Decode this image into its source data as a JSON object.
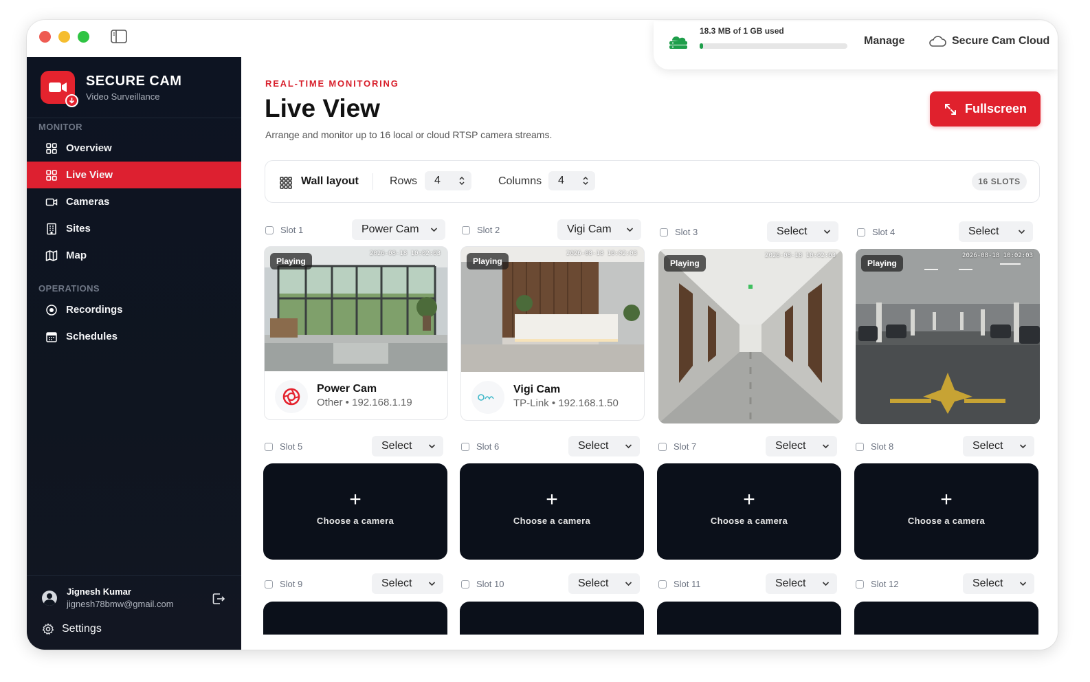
{
  "storage": {
    "used_text": "18.3 MB of 1 GB used",
    "used_fraction": 0.018,
    "manage_label": "Manage",
    "cloud_label": "Secure Cam Cloud",
    "accent": "#1e9e4a"
  },
  "brand": {
    "title": "SECURE CAM",
    "subtitle": "Video Surveillance",
    "color": "#e4232e"
  },
  "sidebar": {
    "sections": [
      {
        "label": "MONITOR",
        "items": [
          {
            "label": "Overview",
            "icon": "grid-icon",
            "active": false
          },
          {
            "label": "Live View",
            "icon": "grid-icon",
            "active": true
          },
          {
            "label": "Cameras",
            "icon": "camera-icon",
            "active": false
          },
          {
            "label": "Sites",
            "icon": "building-icon",
            "active": false
          },
          {
            "label": "Map",
            "icon": "map-icon",
            "active": false
          }
        ]
      },
      {
        "label": "OPERATIONS",
        "items": [
          {
            "label": "Recordings",
            "icon": "record-icon",
            "active": false
          },
          {
            "label": "Schedules",
            "icon": "calendar-icon",
            "active": false
          }
        ]
      }
    ],
    "user": {
      "name": "Jignesh Kumar",
      "email": "jignesh78bmw@gmail.com"
    },
    "settings_label": "Settings"
  },
  "header": {
    "eyebrow": "REAL-TIME MONITORING",
    "title": "Live View",
    "description": "Arrange and monitor up to 16 local or cloud RTSP camera streams.",
    "fullscreen_label": "Fullscreen"
  },
  "toolbar": {
    "wall_layout_label": "Wall layout",
    "rows_label": "Rows",
    "rows_value": "4",
    "columns_label": "Columns",
    "columns_value": "4",
    "slots_badge": "16 SLOTS"
  },
  "slots": [
    {
      "label": "Slot 1",
      "select": "Power Cam",
      "state": "card",
      "status": "Playing",
      "timestamp": "2026-08-18 10:02:03",
      "camera_name": "Power Cam",
      "camera_meta": "Other • 192.168.1.19",
      "scene": "lobby-glass"
    },
    {
      "label": "Slot 2",
      "select": "Vigi Cam",
      "state": "card",
      "status": "Playing",
      "timestamp": "2026-08-18 10:02:03",
      "camera_name": "Vigi Cam",
      "camera_meta": "TP-Link • 192.168.1.50",
      "scene": "reception"
    },
    {
      "label": "Slot 3",
      "select": "Select",
      "state": "feed",
      "status": "Playing",
      "timestamp": "2026-08-18 10:02:03",
      "scene": "corridor"
    },
    {
      "label": "Slot 4",
      "select": "Select",
      "state": "feed",
      "status": "Playing",
      "timestamp": "2026-08-18 10:02:03",
      "scene": "parking"
    },
    {
      "label": "Slot 5",
      "select": "Select",
      "state": "empty",
      "prompt": "Choose a camera"
    },
    {
      "label": "Slot 6",
      "select": "Select",
      "state": "empty",
      "prompt": "Choose a camera"
    },
    {
      "label": "Slot 7",
      "select": "Select",
      "state": "empty",
      "prompt": "Choose a camera"
    },
    {
      "label": "Slot 8",
      "select": "Select",
      "state": "empty",
      "prompt": "Choose a camera"
    },
    {
      "label": "Slot 9",
      "select": "Select",
      "state": "empty-clipped"
    },
    {
      "label": "Slot 10",
      "select": "Select",
      "state": "empty-clipped"
    },
    {
      "label": "Slot 11",
      "select": "Select",
      "state": "empty-clipped"
    },
    {
      "label": "Slot 12",
      "select": "Select",
      "state": "empty-clipped"
    }
  ]
}
